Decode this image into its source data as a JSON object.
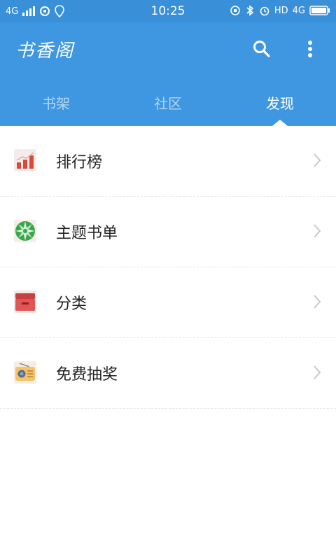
{
  "status_bar": {
    "network_left": "4G",
    "time": "10:25",
    "hd_label": "HD",
    "network_right": "4G"
  },
  "app": {
    "logo_text": "书香阁"
  },
  "tabs": [
    {
      "label": "书架",
      "active": false
    },
    {
      "label": "社区",
      "active": false
    },
    {
      "label": "发现",
      "active": true
    }
  ],
  "items": [
    {
      "label": "排行榜",
      "icon": "ranking-chart-icon"
    },
    {
      "label": "主题书单",
      "icon": "candy-icon"
    },
    {
      "label": "分类",
      "icon": "drawer-box-icon"
    },
    {
      "label": "免费抽奖",
      "icon": "radio-icon"
    }
  ],
  "colors": {
    "status_bar": "#3a8fd9",
    "app_bar": "#3e97e0",
    "active_tab": "#ffffff"
  }
}
